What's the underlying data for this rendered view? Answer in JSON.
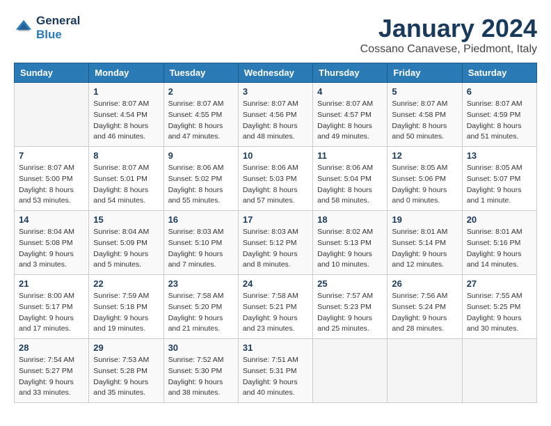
{
  "logo": {
    "line1": "General",
    "line2": "Blue"
  },
  "title": "January 2024",
  "subtitle": "Cossano Canavese, Piedmont, Italy",
  "weekdays": [
    "Sunday",
    "Monday",
    "Tuesday",
    "Wednesday",
    "Thursday",
    "Friday",
    "Saturday"
  ],
  "weeks": [
    [
      {
        "day": null
      },
      {
        "day": "1",
        "sunrise": "Sunrise: 8:07 AM",
        "sunset": "Sunset: 4:54 PM",
        "daylight": "Daylight: 8 hours and 46 minutes."
      },
      {
        "day": "2",
        "sunrise": "Sunrise: 8:07 AM",
        "sunset": "Sunset: 4:55 PM",
        "daylight": "Daylight: 8 hours and 47 minutes."
      },
      {
        "day": "3",
        "sunrise": "Sunrise: 8:07 AM",
        "sunset": "Sunset: 4:56 PM",
        "daylight": "Daylight: 8 hours and 48 minutes."
      },
      {
        "day": "4",
        "sunrise": "Sunrise: 8:07 AM",
        "sunset": "Sunset: 4:57 PM",
        "daylight": "Daylight: 8 hours and 49 minutes."
      },
      {
        "day": "5",
        "sunrise": "Sunrise: 8:07 AM",
        "sunset": "Sunset: 4:58 PM",
        "daylight": "Daylight: 8 hours and 50 minutes."
      },
      {
        "day": "6",
        "sunrise": "Sunrise: 8:07 AM",
        "sunset": "Sunset: 4:59 PM",
        "daylight": "Daylight: 8 hours and 51 minutes."
      }
    ],
    [
      {
        "day": "7",
        "sunrise": "Sunrise: 8:07 AM",
        "sunset": "Sunset: 5:00 PM",
        "daylight": "Daylight: 8 hours and 53 minutes."
      },
      {
        "day": "8",
        "sunrise": "Sunrise: 8:07 AM",
        "sunset": "Sunset: 5:01 PM",
        "daylight": "Daylight: 8 hours and 54 minutes."
      },
      {
        "day": "9",
        "sunrise": "Sunrise: 8:06 AM",
        "sunset": "Sunset: 5:02 PM",
        "daylight": "Daylight: 8 hours and 55 minutes."
      },
      {
        "day": "10",
        "sunrise": "Sunrise: 8:06 AM",
        "sunset": "Sunset: 5:03 PM",
        "daylight": "Daylight: 8 hours and 57 minutes."
      },
      {
        "day": "11",
        "sunrise": "Sunrise: 8:06 AM",
        "sunset": "Sunset: 5:04 PM",
        "daylight": "Daylight: 8 hours and 58 minutes."
      },
      {
        "day": "12",
        "sunrise": "Sunrise: 8:05 AM",
        "sunset": "Sunset: 5:06 PM",
        "daylight": "Daylight: 9 hours and 0 minutes."
      },
      {
        "day": "13",
        "sunrise": "Sunrise: 8:05 AM",
        "sunset": "Sunset: 5:07 PM",
        "daylight": "Daylight: 9 hours and 1 minute."
      }
    ],
    [
      {
        "day": "14",
        "sunrise": "Sunrise: 8:04 AM",
        "sunset": "Sunset: 5:08 PM",
        "daylight": "Daylight: 9 hours and 3 minutes."
      },
      {
        "day": "15",
        "sunrise": "Sunrise: 8:04 AM",
        "sunset": "Sunset: 5:09 PM",
        "daylight": "Daylight: 9 hours and 5 minutes."
      },
      {
        "day": "16",
        "sunrise": "Sunrise: 8:03 AM",
        "sunset": "Sunset: 5:10 PM",
        "daylight": "Daylight: 9 hours and 7 minutes."
      },
      {
        "day": "17",
        "sunrise": "Sunrise: 8:03 AM",
        "sunset": "Sunset: 5:12 PM",
        "daylight": "Daylight: 9 hours and 8 minutes."
      },
      {
        "day": "18",
        "sunrise": "Sunrise: 8:02 AM",
        "sunset": "Sunset: 5:13 PM",
        "daylight": "Daylight: 9 hours and 10 minutes."
      },
      {
        "day": "19",
        "sunrise": "Sunrise: 8:01 AM",
        "sunset": "Sunset: 5:14 PM",
        "daylight": "Daylight: 9 hours and 12 minutes."
      },
      {
        "day": "20",
        "sunrise": "Sunrise: 8:01 AM",
        "sunset": "Sunset: 5:16 PM",
        "daylight": "Daylight: 9 hours and 14 minutes."
      }
    ],
    [
      {
        "day": "21",
        "sunrise": "Sunrise: 8:00 AM",
        "sunset": "Sunset: 5:17 PM",
        "daylight": "Daylight: 9 hours and 17 minutes."
      },
      {
        "day": "22",
        "sunrise": "Sunrise: 7:59 AM",
        "sunset": "Sunset: 5:18 PM",
        "daylight": "Daylight: 9 hours and 19 minutes."
      },
      {
        "day": "23",
        "sunrise": "Sunrise: 7:58 AM",
        "sunset": "Sunset: 5:20 PM",
        "daylight": "Daylight: 9 hours and 21 minutes."
      },
      {
        "day": "24",
        "sunrise": "Sunrise: 7:58 AM",
        "sunset": "Sunset: 5:21 PM",
        "daylight": "Daylight: 9 hours and 23 minutes."
      },
      {
        "day": "25",
        "sunrise": "Sunrise: 7:57 AM",
        "sunset": "Sunset: 5:23 PM",
        "daylight": "Daylight: 9 hours and 25 minutes."
      },
      {
        "day": "26",
        "sunrise": "Sunrise: 7:56 AM",
        "sunset": "Sunset: 5:24 PM",
        "daylight": "Daylight: 9 hours and 28 minutes."
      },
      {
        "day": "27",
        "sunrise": "Sunrise: 7:55 AM",
        "sunset": "Sunset: 5:25 PM",
        "daylight": "Daylight: 9 hours and 30 minutes."
      }
    ],
    [
      {
        "day": "28",
        "sunrise": "Sunrise: 7:54 AM",
        "sunset": "Sunset: 5:27 PM",
        "daylight": "Daylight: 9 hours and 33 minutes."
      },
      {
        "day": "29",
        "sunrise": "Sunrise: 7:53 AM",
        "sunset": "Sunset: 5:28 PM",
        "daylight": "Daylight: 9 hours and 35 minutes."
      },
      {
        "day": "30",
        "sunrise": "Sunrise: 7:52 AM",
        "sunset": "Sunset: 5:30 PM",
        "daylight": "Daylight: 9 hours and 38 minutes."
      },
      {
        "day": "31",
        "sunrise": "Sunrise: 7:51 AM",
        "sunset": "Sunset: 5:31 PM",
        "daylight": "Daylight: 9 hours and 40 minutes."
      },
      {
        "day": null
      },
      {
        "day": null
      },
      {
        "day": null
      }
    ]
  ]
}
